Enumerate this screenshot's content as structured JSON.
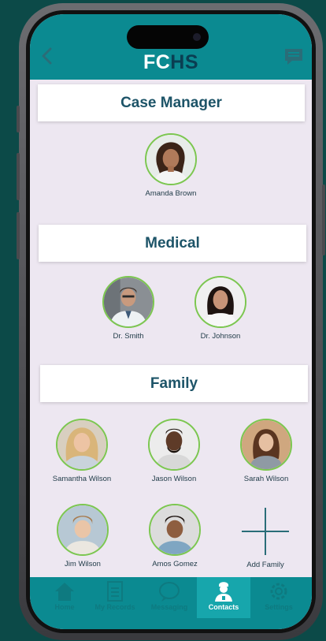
{
  "app": {
    "logo_part1": "FC",
    "logo_part2": "HS"
  },
  "sections": {
    "case_manager": {
      "title": "Case Manager",
      "contacts": [
        {
          "name": "Amanda Brown"
        }
      ]
    },
    "medical": {
      "title": "Medical",
      "contacts": [
        {
          "name": "Dr. Smith"
        },
        {
          "name": "Dr. Johnson"
        }
      ]
    },
    "family": {
      "title": "Family",
      "contacts": [
        {
          "name": "Samantha Wilson"
        },
        {
          "name": "Jason Wilson"
        },
        {
          "name": "Sarah Wilson"
        },
        {
          "name": "Jim Wilson"
        },
        {
          "name": "Amos Gomez"
        }
      ],
      "add_label": "Add Family"
    }
  },
  "tabbar": {
    "home": "Home",
    "records": "My Records",
    "messaging": "Messaging",
    "contacts": "Contacts",
    "settings": "Settings"
  },
  "colors": {
    "header": "#0b8a91",
    "background": "#ede7f1",
    "avatar_ring": "#7cc750",
    "section_text": "#1d5468",
    "logo_accent": "#0a3e52"
  }
}
